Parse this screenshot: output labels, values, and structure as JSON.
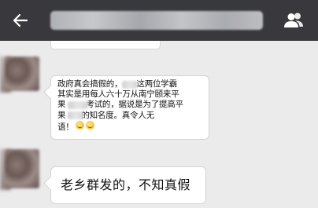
{
  "header": {
    "back_icon": "arrow-left-icon",
    "contacts_icon": "people-icon",
    "bar_color": "#39393d"
  },
  "messages": [
    {
      "line1_part1": "政府真会搞假的，",
      "line1_part2": "这两位学霸",
      "line2": "其实是用每人六十万从南宁颐来平",
      "line3_part1": "果",
      "line3_part2": "考试的，据说是为了提高平",
      "line4_part1": "果",
      "line4_part2": "的知名度。真令人无",
      "line5": "语！"
    },
    {
      "text": "老乡群发的，不知真假"
    }
  ]
}
